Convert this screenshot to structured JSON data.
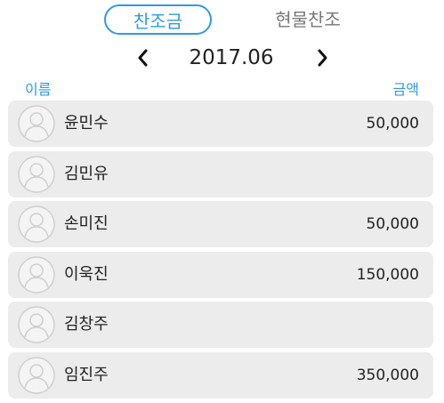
{
  "tabs": [
    {
      "label": "찬조금",
      "active": true
    },
    {
      "label": "현물찬조",
      "active": false
    }
  ],
  "month_nav": {
    "prev_icon": "chevron-left-icon",
    "next_icon": "chevron-right-icon",
    "current": "2017.06"
  },
  "columns": {
    "name": "이름",
    "amount": "금액"
  },
  "members": [
    {
      "name": "윤민수",
      "amount": "50,000"
    },
    {
      "name": "김민유",
      "amount": ""
    },
    {
      "name": "손미진",
      "amount": "50,000"
    },
    {
      "name": "이욱진",
      "amount": "150,000"
    },
    {
      "name": "김창주",
      "amount": ""
    },
    {
      "name": "임진주",
      "amount": "350,000"
    }
  ],
  "colors": {
    "accent": "#2e9ae6",
    "row_background": "#ececec",
    "avatar_outline": "#cfcfcf"
  }
}
